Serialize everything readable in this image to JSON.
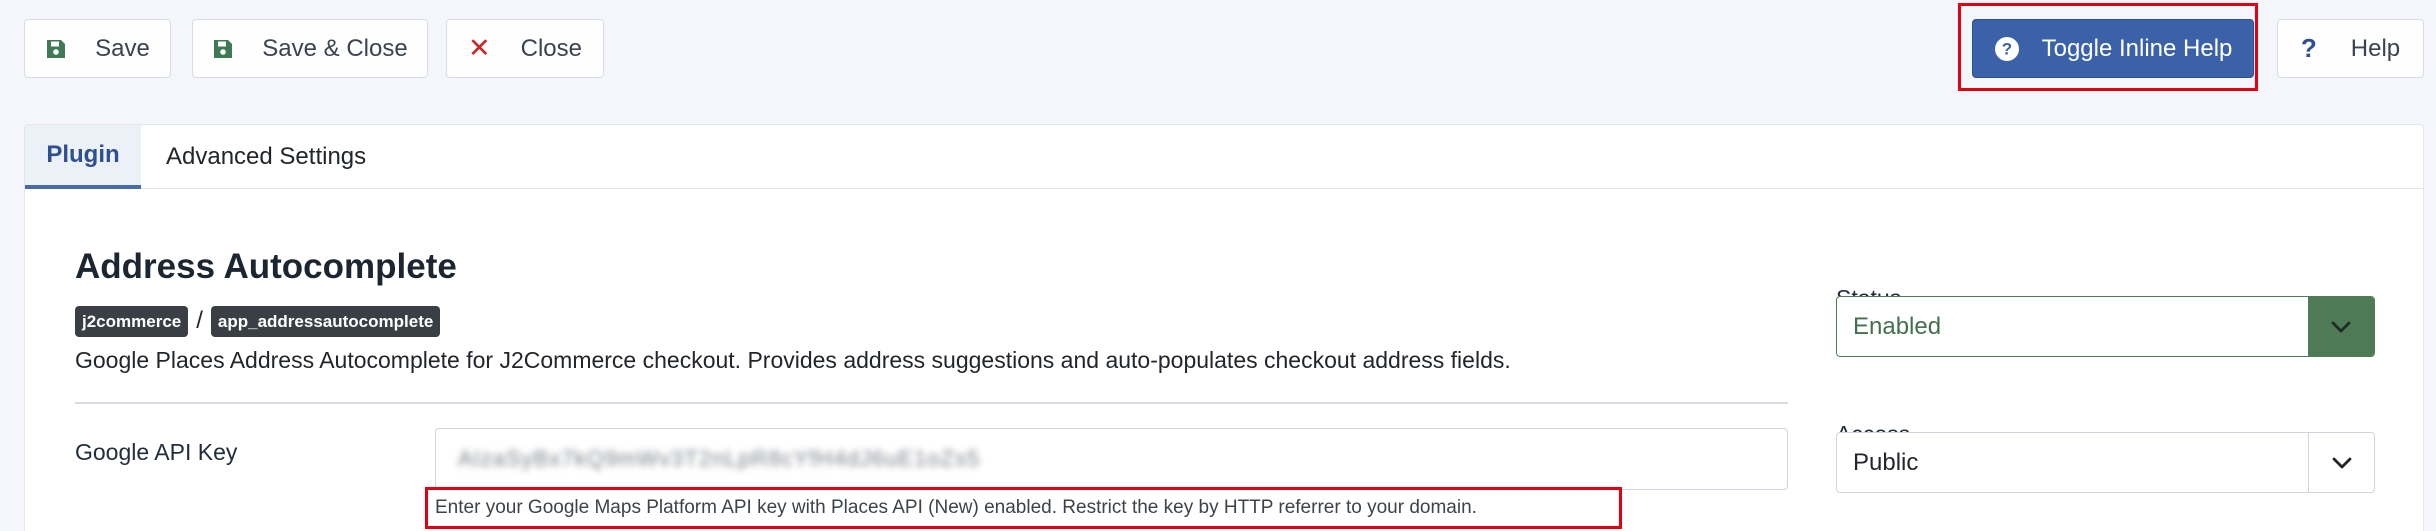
{
  "toolbar": {
    "save_label": "Save",
    "save_close_label": "Save & Close",
    "close_label": "Close",
    "toggle_help_label": "Toggle Inline Help",
    "help_label": "Help",
    "help_glyph": "?",
    "close_glyph": "✕"
  },
  "tabs": [
    {
      "label": "Plugin",
      "active": true
    },
    {
      "label": "Advanced Settings",
      "active": false
    }
  ],
  "plugin": {
    "title": "Address Autocomplete",
    "badges": [
      "j2commerce",
      "app_addressautocomplete"
    ],
    "badge_separator": "/",
    "description": "Google Places Address Autocomplete for J2Commerce checkout. Provides address suggestions and auto-populates checkout address fields."
  },
  "api_key": {
    "label": "Google API Key",
    "value": "AIzaSyBx7kQ9mWv3T2nLpR8cYfH4dJ6uE1oZs5",
    "help_text": "Enter your Google Maps Platform API key with Places API (New) enabled. Restrict the key by HTTP referrer to your domain."
  },
  "status": {
    "label": "Status",
    "value": "Enabled"
  },
  "access": {
    "label": "Access",
    "value": "Public"
  },
  "colors": {
    "primary": "#3b62a8",
    "success": "#4e7b55",
    "danger": "#c52827",
    "highlight": "#e00011"
  },
  "icons": {
    "save": "floppy-disk-icon",
    "close": "x-icon",
    "toggle_help": "question-circle-icon",
    "help": "question-icon",
    "select_arrow": "chevron-down-icon"
  }
}
